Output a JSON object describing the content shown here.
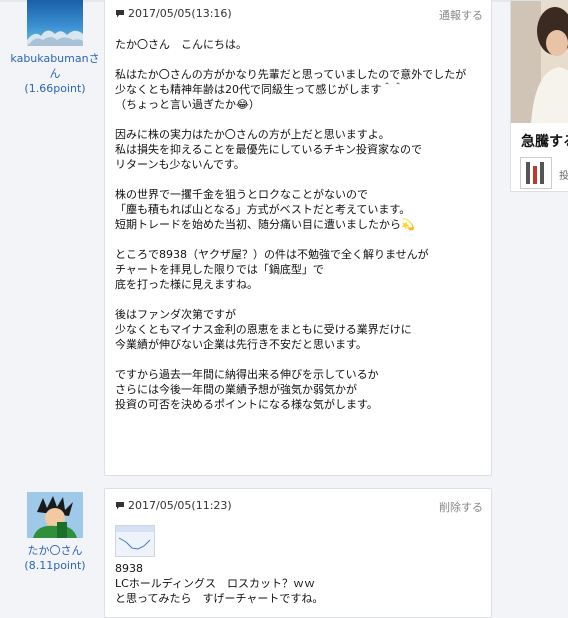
{
  "posts": [
    {
      "user": {
        "name": "kabukabumanさん",
        "point": "(1.66point)"
      },
      "date": "2017/05/05(13:16)",
      "action_label": "通報する",
      "body": "たか〇さん　こんにちは。\n\n私はたか〇さんの方がかなり先輩だと思っていましたので意外でしたが\n少なくとも精神年齢は20代で同級生って感じがします＾＾\n（ちょっと言い過ぎたか😂）\n\n因みに株の実力はたか〇さんの方が上だと思いますよ。\n私は損失を抑えることを最優先にしているチキン投資家なので\nリターンも少ないんです。\n\n株の世界で一攫千金を狙うとロクなことがないので\n「塵も積もれば山となる」方式がベストだと考えています。\n短期トレードを始めた当初、随分痛い目に遭いましたから💫\n\nところで8938（ヤクザ屋？）の件は不勉強で全く解りませんが\nチャートを拝見した限りでは「鍋底型」で\n底を打った様に見えますね。\n\n後はファンダ次第ですが\n少なくともマイナス金利の恩恵をまともに受ける業界だけに\n今業績が伸びない企業は先行き不安だと思います。\n\nですから過去一年間に納得出来る伸びを示しているか\nさらには今後一年間の業績予想が強気か弱気かが\n投資の可否を決めるポイントになる様な気がします。"
    },
    {
      "user": {
        "name": "たか〇さん",
        "point": "(8.11point)"
      },
      "date": "2017/05/05(11:23)",
      "action_label": "削除する",
      "body": "8938\nLCホールディングス　ロスカット？ｗｗ\nと思ってみたら　すげーチャートですね。"
    }
  ],
  "side_panel": {
    "title": "急騰する",
    "tiny_text": "投"
  },
  "colors": {
    "link": "#2a66b7",
    "card_border": "#dcdfe3",
    "background": "#f2f4f7"
  }
}
